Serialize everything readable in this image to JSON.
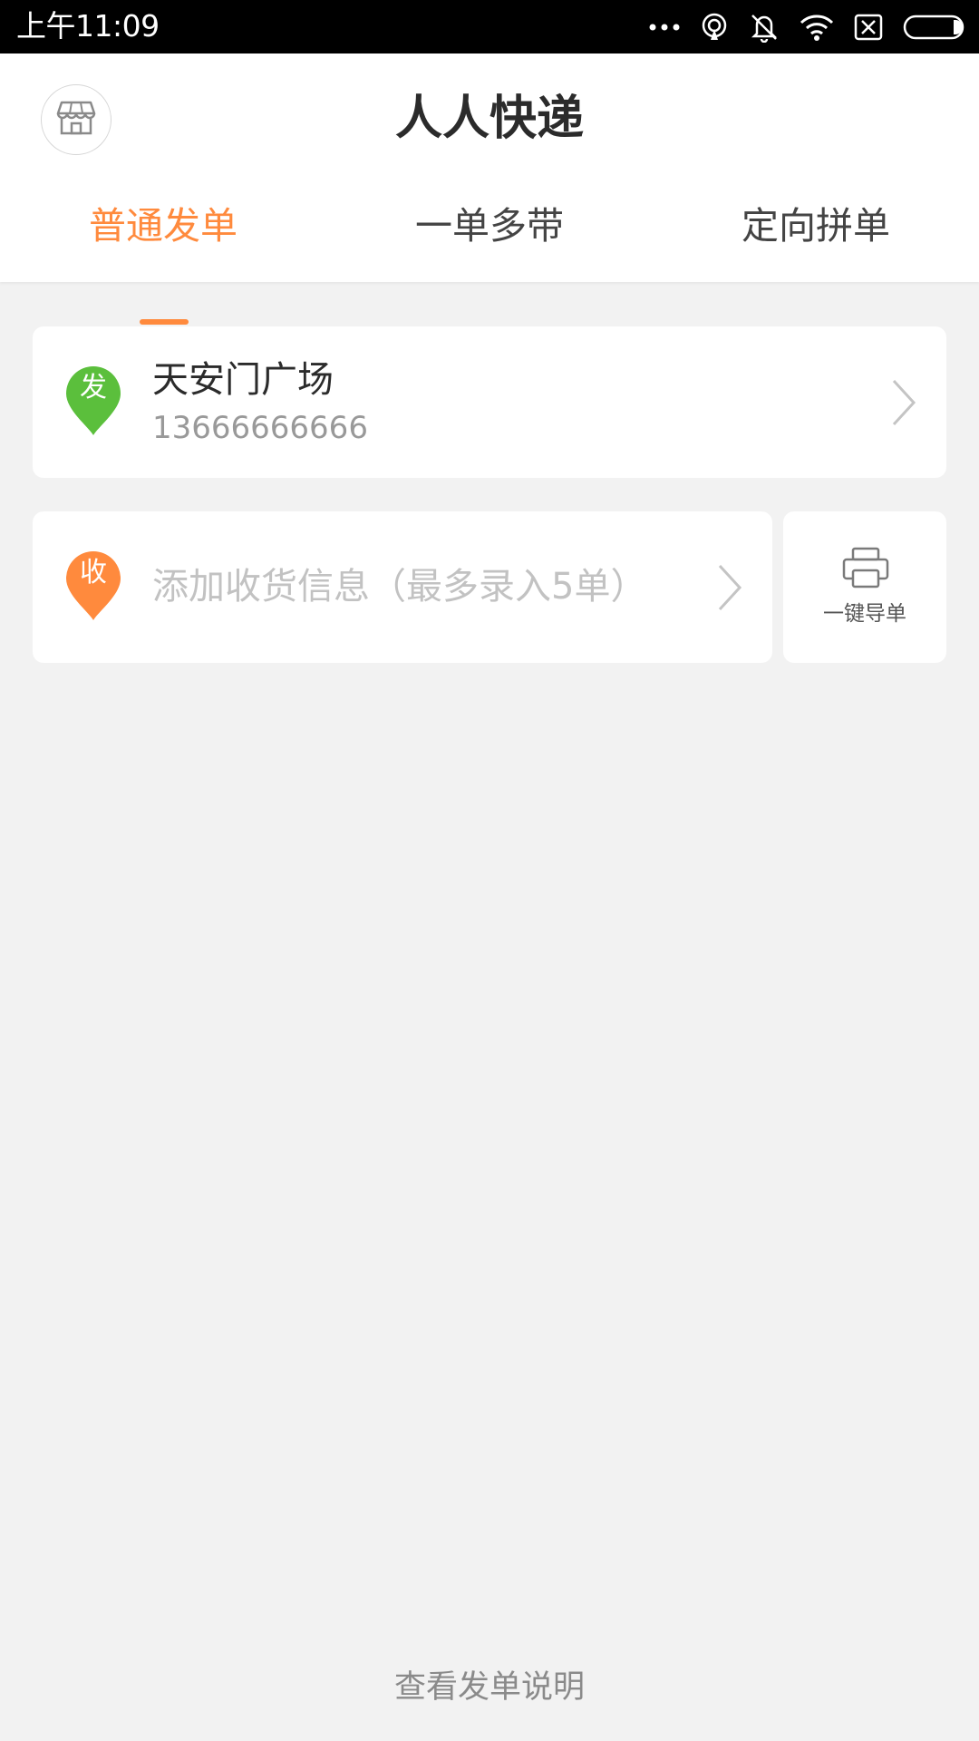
{
  "status_bar": {
    "time": "上午11:09",
    "icons": [
      "more-dots-icon",
      "hotspot-icon",
      "silent-mode-icon",
      "wifi-icon",
      "no-sim-icon",
      "battery-icon"
    ]
  },
  "header": {
    "title": "人人快递",
    "store_icon": "store-icon"
  },
  "tabs": [
    {
      "label": "普通发单",
      "active": true
    },
    {
      "label": "一单多带",
      "active": false
    },
    {
      "label": "定向拼单",
      "active": false
    }
  ],
  "sender": {
    "badge": "发",
    "name": "天安门广场",
    "phone": "13666666666",
    "badge_color": "#5bbf3c"
  },
  "receiver": {
    "badge": "收",
    "placeholder": "添加收货信息（最多录入5单）",
    "badge_color": "#ff8a3d"
  },
  "import": {
    "label": "一键导单",
    "icon": "printer-icon"
  },
  "footer": {
    "link": "查看发单说明"
  },
  "colors": {
    "accent": "#ff8a3d",
    "background": "#f2f2f2",
    "sender_green": "#5bbf3c"
  }
}
